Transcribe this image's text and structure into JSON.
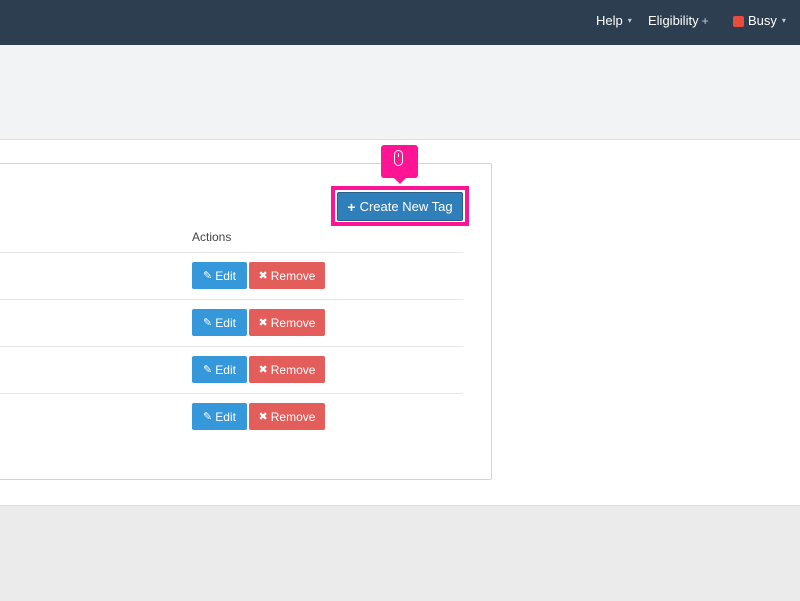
{
  "navbar": {
    "help_label": "Help",
    "eligibility_label": "Eligibility",
    "status_label": "Busy",
    "status_color": "#e74c3c",
    "caret_glyph": "▾",
    "plus_glyph": "+"
  },
  "panel": {
    "create_button_icon": "+",
    "create_button_label": "Create New Tag",
    "actions_header": "Actions",
    "rows": [
      {
        "edit_label": "Edit",
        "remove_label": "Remove"
      },
      {
        "edit_label": "Edit",
        "remove_label": "Remove"
      },
      {
        "edit_label": "Edit",
        "remove_label": "Remove"
      },
      {
        "edit_label": "Edit",
        "remove_label": "Remove"
      }
    ],
    "edit_icon": "✎",
    "remove_icon": "✖"
  },
  "colors": {
    "navbar_bg": "#2c3e50",
    "create_btn": "#2f7fba",
    "edit_btn": "#3498db",
    "remove_btn": "#e35d5b",
    "highlight": "#ff1493"
  },
  "icons": {
    "pointer": "mouse-icon"
  }
}
